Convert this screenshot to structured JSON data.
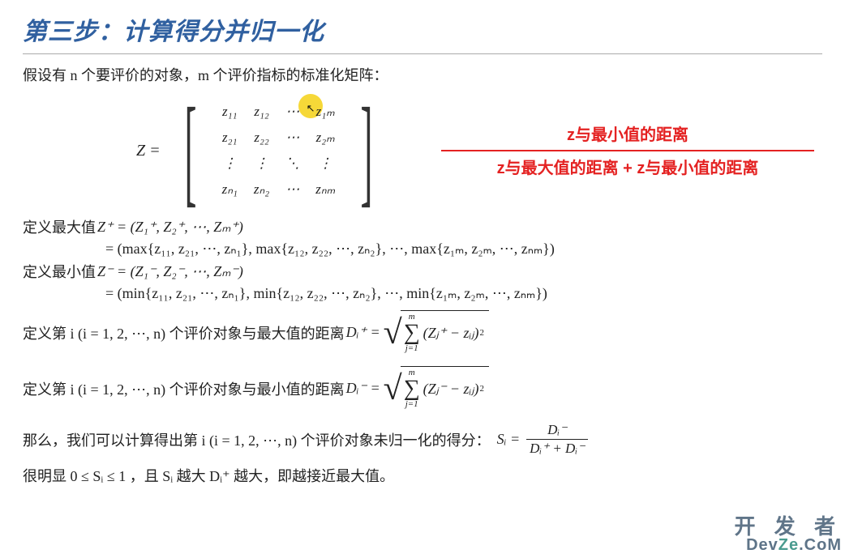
{
  "title": "第三步：计算得分并归一化",
  "intro": "假设有 n 个要评价的对象，m 个评价指标的标准化矩阵：",
  "matrix_eq_lhs": "Z  =",
  "matrix": {
    "r1": [
      "z₁₁",
      "z₁₂",
      "⋯",
      "z₁ₘ"
    ],
    "r2": [
      "z₂₁",
      "z₂₂",
      "⋯",
      "z₂ₘ"
    ],
    "r3": [
      "⋮",
      "⋮",
      "⋱",
      "⋮"
    ],
    "r4": [
      "zₙ₁",
      "zₙ₂",
      "⋯",
      "zₙₘ"
    ]
  },
  "red_formula": {
    "numerator": "z与最小值的距离",
    "denominator": "z与最大值的距离 + z与最小值的距离"
  },
  "def_max_label": "定义最大值",
  "def_max_line1": "Z⁺ = (Z₁⁺, Z₂⁺, ⋯, Zₘ⁺)",
  "def_max_line2": "= (max{z₁₁, z₂₁, ⋯, zₙ₁}, max{z₁₂, z₂₂, ⋯, zₙ₂}, ⋯, max{z₁ₘ, z₂ₘ, ⋯, zₙₘ})",
  "def_min_label": "定义最小值",
  "def_min_line1": "Z⁻ = (Z₁⁻, Z₂⁻, ⋯, Zₘ⁻)",
  "def_min_line2": "= (min{z₁₁, z₂₁, ⋯, zₙ₁}, min{z₁₂, z₂₂, ⋯, zₙ₂}, ⋯, min{z₁ₘ, z₂ₘ, ⋯, zₙₘ})",
  "dist_plus_pre": "定义第 i (i = 1, 2, ⋯, n) 个评价对象与最大值的距离",
  "dist_plus_sym": "Dᵢ⁺ =",
  "dist_minus_pre": "定义第 i (i = 1, 2, ⋯, n) 个评价对象与最小值的距离",
  "dist_minus_sym": "Dᵢ⁻ =",
  "sum_top": "m",
  "sum_bot": "j=1",
  "inner_plus": "(Zⱼ⁺ − zᵢⱼ)",
  "inner_minus": "(Zⱼ⁻ − zᵢⱼ)",
  "squared": "2",
  "score_pre": "那么，我们可以计算得出第 i (i = 1, 2, ⋯, n) 个评价对象未归一化的得分：",
  "score_sym": "Sᵢ  =",
  "frac_num": "Dᵢ⁻",
  "frac_den": "Dᵢ⁺ + Dᵢ⁻",
  "last_line": "很明显 0 ≤ Sᵢ ≤ 1 ，且 Sᵢ 越大 Dᵢ⁺ 越大，即越接近最大值。",
  "watermark": {
    "line1": "开 发 者",
    "line2a": "Dev",
    "line2b": "Ze",
    "line2c": ".CoM"
  }
}
